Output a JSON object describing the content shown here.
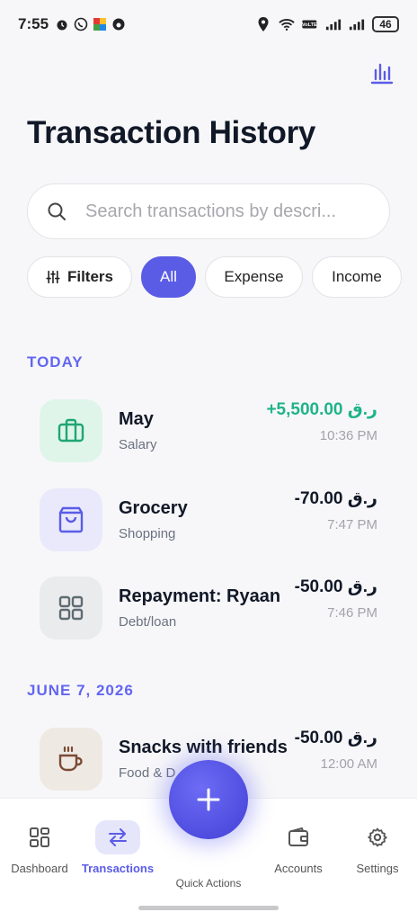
{
  "status_bar": {
    "time": "7:55",
    "battery": "46"
  },
  "header": {
    "title": "Transaction History"
  },
  "search": {
    "placeholder": "Search transactions by descri..."
  },
  "filters": {
    "filters_label": "Filters",
    "all_label": "All",
    "expense_label": "Expense",
    "income_label": "Income",
    "selected": "All"
  },
  "sections": [
    {
      "header": "TODAY",
      "transactions": [
        {
          "title": "May",
          "category": "Salary",
          "amount": "+5,500.00 ر.ق",
          "time": "10:36 PM",
          "icon": "briefcase-icon"
        },
        {
          "title": "Grocery",
          "category": "Shopping",
          "amount": "-70.00 ر.ق",
          "time": "7:47 PM",
          "icon": "shopping-bag-icon"
        },
        {
          "title": "Repayment: Ryaan",
          "category": "Debt/loan",
          "amount": "-50.00 ر.ق",
          "time": "7:46 PM",
          "icon": "grid-icon"
        }
      ]
    },
    {
      "header": "JUNE 7, 2026",
      "transactions": [
        {
          "title": "Snacks with friends",
          "category": "Food & D",
          "amount": "-50.00 ر.ق",
          "time": "12:00 AM",
          "icon": "coffee-cup-icon"
        }
      ]
    }
  ],
  "colors": {
    "accent": "#5b5ce6",
    "income": "#1fb38a",
    "section_header": "#6366f1"
  },
  "bottom_nav": {
    "dashboard": "Dashboard",
    "transactions": "Transactions",
    "quick_actions": "Quick Actions",
    "accounts": "Accounts",
    "settings": "Settings",
    "active": "Transactions"
  }
}
